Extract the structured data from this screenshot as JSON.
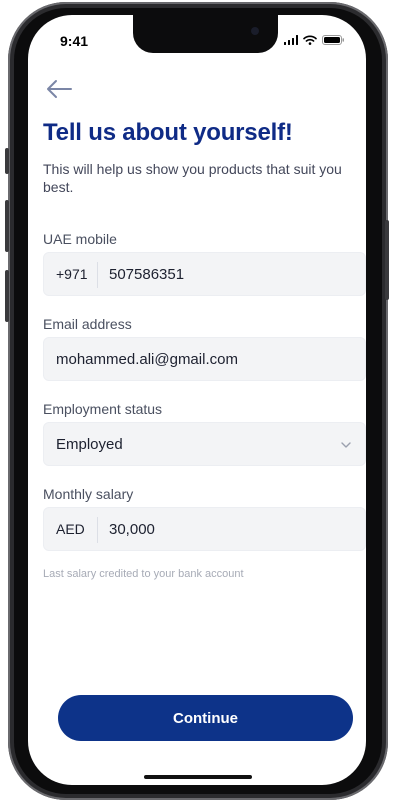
{
  "status_bar": {
    "time": "9:41"
  },
  "header": {
    "title": "Tell us about yourself!",
    "subtitle": "This will help us show you products that suit you best."
  },
  "form": {
    "mobile": {
      "label": "UAE mobile",
      "prefix": "+971",
      "value": "507586351"
    },
    "email": {
      "label": "Email address",
      "value": "mohammed.ali@gmail.com"
    },
    "employment": {
      "label": "Employment status",
      "value": "Employed"
    },
    "salary": {
      "label": "Monthly salary",
      "currency": "AED",
      "value": "30,000",
      "hint": "Last salary credited to your bank account"
    }
  },
  "actions": {
    "continue_label": "Continue"
  },
  "colors": {
    "brand": "#0f2b86",
    "button": "#0d3389",
    "field_bg": "#f3f4f6"
  }
}
